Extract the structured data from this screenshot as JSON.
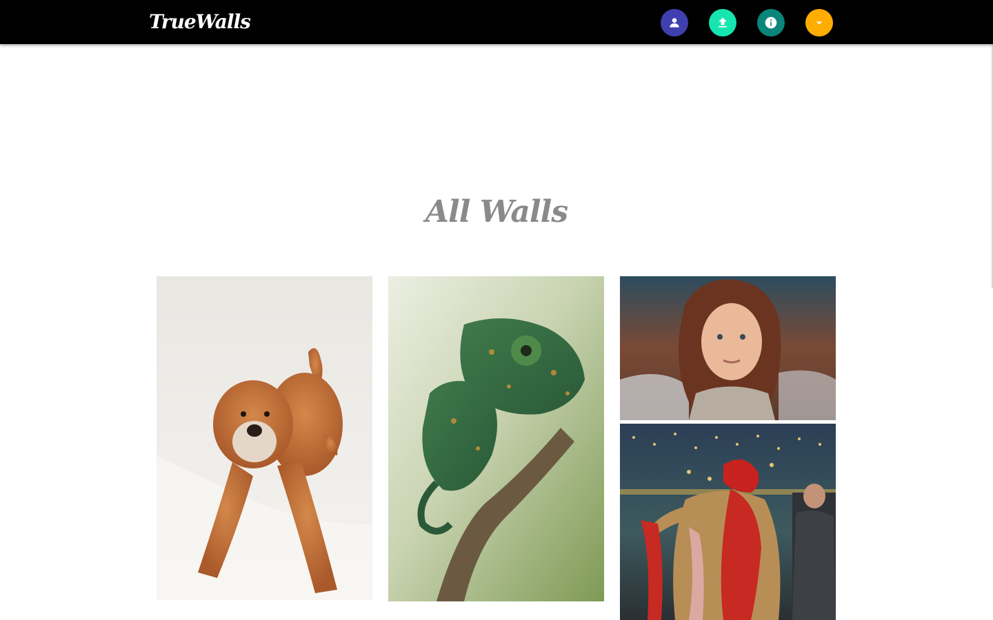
{
  "app": {
    "brand": "TrueWalls"
  },
  "navbar": {
    "buttons": [
      {
        "id": "profile",
        "icon": "person-icon",
        "color": "#3f3fb0"
      },
      {
        "id": "upload",
        "icon": "upload-icon",
        "color": "#16e5b0"
      },
      {
        "id": "info",
        "icon": "info-icon",
        "color": "#0a857a"
      },
      {
        "id": "menu",
        "icon": "caret-down-icon",
        "color": "#ffad00"
      }
    ]
  },
  "main": {
    "title": "All Walls"
  },
  "gallery": {
    "items": [
      {
        "subject": "dog-in-snow-photo"
      },
      {
        "subject": "chameleon-on-branch-photo"
      },
      {
        "subject": "woman-portrait-photo"
      },
      {
        "subject": "wedding-groom-photo"
      }
    ]
  }
}
